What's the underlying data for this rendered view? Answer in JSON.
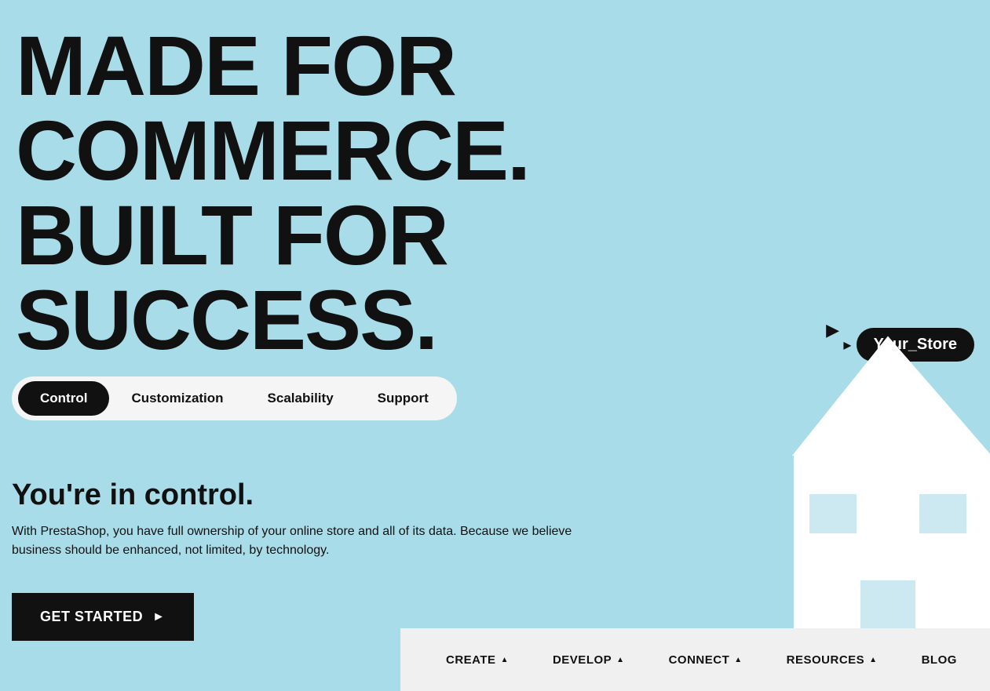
{
  "hero": {
    "headline_line1": "MADE FOR",
    "headline_line2": "COMMERCE.",
    "headline_line3": "BUILT FOR",
    "headline_line4": "SUCCESS."
  },
  "tabs": [
    {
      "id": "control",
      "label": "Control",
      "active": true
    },
    {
      "id": "customization",
      "label": "Customization",
      "active": false
    },
    {
      "id": "scalability",
      "label": "Scalability",
      "active": false
    },
    {
      "id": "support",
      "label": "Support",
      "active": false
    }
  ],
  "subheadline": "You're in control.",
  "body_text_line1": "With PrestaShop, you have full ownership of your online store and all of its data. Because we believe",
  "body_text_line2": "business should be enhanced, not limited, by technology.",
  "cta_button": {
    "label": "GET STARTED",
    "arrow": "►"
  },
  "store_tooltip": {
    "label": "Your_Store",
    "cursor": "▶"
  },
  "bottom_nav": {
    "items": [
      {
        "id": "create",
        "label": "CREATE",
        "has_arrow": true
      },
      {
        "id": "develop",
        "label": "DEVELOP",
        "has_arrow": true
      },
      {
        "id": "connect",
        "label": "CONNECT",
        "has_arrow": true
      },
      {
        "id": "resources",
        "label": "RESOURCES",
        "has_arrow": true
      },
      {
        "id": "blog",
        "label": "BLOG",
        "has_arrow": false
      }
    ]
  },
  "colors": {
    "background": "#a8dce8",
    "text_dark": "#111111",
    "tab_active_bg": "#111111",
    "tab_active_text": "#ffffff",
    "nav_bg": "#f0f0f0",
    "tooltip_bg": "#111111",
    "tooltip_text": "#ffffff"
  }
}
